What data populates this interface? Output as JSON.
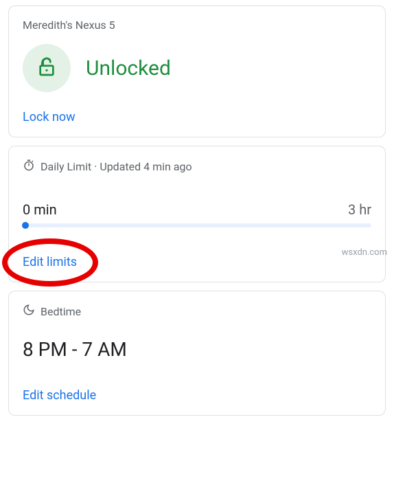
{
  "deviceCard": {
    "device_name": "Meredith's Nexus 5",
    "status_label": "Unlocked",
    "lock_action": "Lock now"
  },
  "dailyLimitCard": {
    "section_label": "Daily Limit",
    "updated_text": "Updated 4 min ago",
    "current_usage": "0 min",
    "limit_value": "3 hr",
    "edit_action": "Edit limits"
  },
  "bedtimeCard": {
    "section_label": "Bedtime",
    "time_range": "8 PM - 7 AM",
    "edit_action": "Edit schedule"
  },
  "watermark": "wsxdn.com"
}
